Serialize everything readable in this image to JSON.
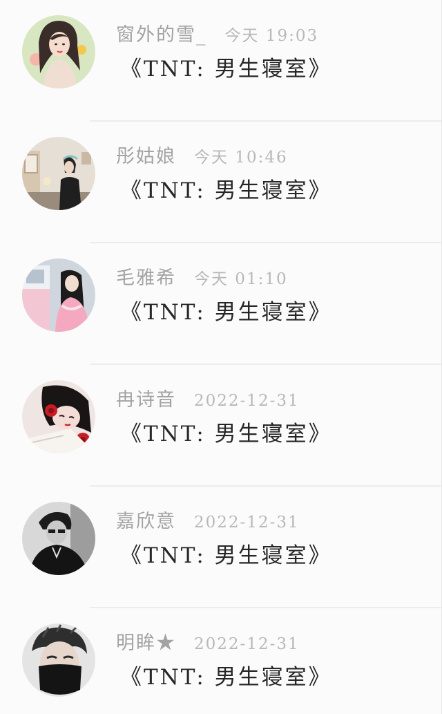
{
  "conversations": [
    {
      "name": "窗外的雪_",
      "time": "今天 19:03",
      "message": "《TNT: 男生寝室》",
      "avatar_icon": "girl-portrait-illustration-avatar"
    },
    {
      "name": "彤姑娘",
      "time": "今天 10:46",
      "message": "《TNT: 男生寝室》",
      "avatar_icon": "girl-in-room-avatar"
    },
    {
      "name": "毛雅希",
      "time": "今天 01:10",
      "message": "《TNT: 男生寝室》",
      "avatar_icon": "girl-pink-dress-avatar"
    },
    {
      "name": "冉诗音",
      "time": "2022-12-31",
      "message": "《TNT: 男生寝室》",
      "avatar_icon": "girl-red-roses-avatar"
    },
    {
      "name": "嘉欣意",
      "time": "2022-12-31",
      "message": "《TNT: 男生寝室》",
      "avatar_icon": "boy-black-white-avatar"
    },
    {
      "name": "明眸★",
      "time": "2022-12-31",
      "message": "《TNT: 男生寝室》",
      "avatar_icon": "boy-black-mask-avatar"
    }
  ],
  "colors": {
    "name_text": "#a3a3a3",
    "time_text": "#b8b8b8",
    "message_text": "#262626",
    "row_background": "#fbfbfb",
    "divider": "#ececec"
  }
}
